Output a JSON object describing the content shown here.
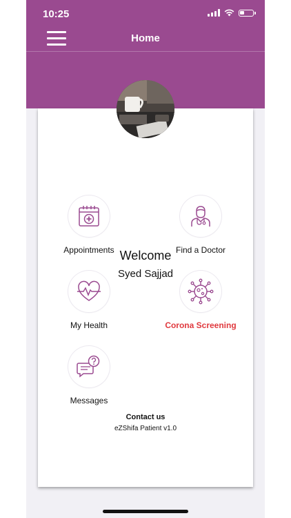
{
  "status_bar": {
    "time": "10:25"
  },
  "nav": {
    "title": "Home"
  },
  "profile": {
    "welcome": "Welcome",
    "name": "Syed Sajjad"
  },
  "menu": [
    {
      "label": "Appointments",
      "icon": "calendar-medical-icon"
    },
    {
      "label": "Find a Doctor",
      "icon": "doctor-icon"
    },
    {
      "label": "My Health",
      "icon": "heartbeat-icon"
    },
    {
      "label": "Corona Screening",
      "icon": "virus-icon"
    },
    {
      "label": "Messages",
      "icon": "chat-question-icon"
    }
  ],
  "footer": {
    "contact": "Contact us",
    "version": "eZShifa Patient v1.0"
  },
  "colors": {
    "brand": "#9a4a90",
    "alert": "#e0393e"
  }
}
